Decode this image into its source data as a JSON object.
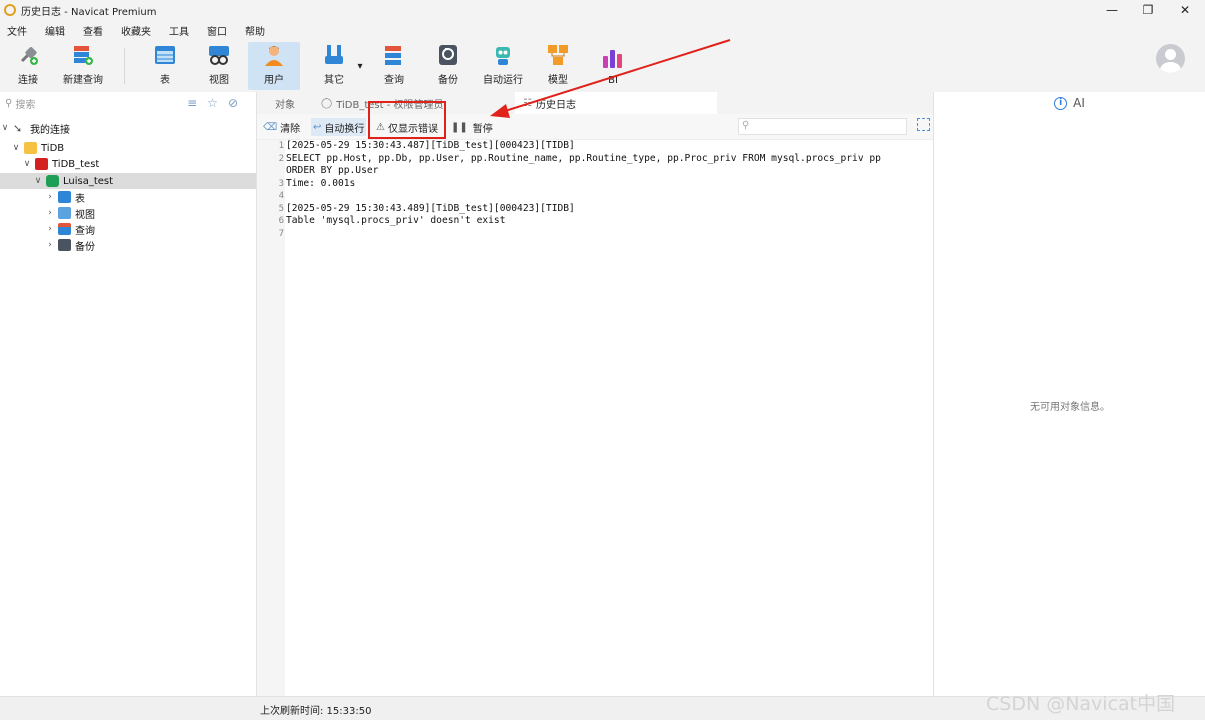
{
  "window": {
    "title": "历史日志 - Navicat Premium"
  },
  "menu": [
    "文件",
    "编辑",
    "查看",
    "收藏夹",
    "工具",
    "窗口",
    "帮助"
  ],
  "toolbar": {
    "connect": "连接",
    "new_query": "新建查询",
    "table": "表",
    "view": "视图",
    "user": "用户",
    "other": "其它",
    "query": "查询",
    "backup": "备份",
    "automation": "自动运行",
    "model": "模型",
    "bi": "BI"
  },
  "sidebar": {
    "search_placeholder": "搜索",
    "tree": {
      "root": "我的连接",
      "group": "TiDB",
      "connection": "TiDB_test",
      "database": "Luisa_test",
      "items": [
        "表",
        "视图",
        "查询",
        "备份"
      ]
    }
  },
  "tabs": [
    "对象",
    "TiDB_test - 权限管理员",
    "历史日志"
  ],
  "log_toolbar": {
    "clear": "清除",
    "word_wrap": "自动换行",
    "errors_only": "仅显示错误",
    "pause": "暂停"
  },
  "log_lines": [
    "[2025-05-29 15:30:43.487][TiDB_test][000423][TIDB]",
    "SELECT pp.Host, pp.Db, pp.User, pp.Routine_name, pp.Routine_type, pp.Proc_priv FROM mysql.procs_priv pp",
    "ORDER BY pp.User",
    "Time: 0.001s",
    "",
    "[2025-05-29 15:30:43.489][TiDB_test][000423][TIDB]",
    "Table 'mysql.procs_priv' doesn't exist",
    ""
  ],
  "line_numbers": [
    "1",
    "2",
    "",
    "3",
    "4",
    "5",
    "6",
    "7"
  ],
  "right_panel": {
    "title": "AI",
    "empty": "无可用对象信息。"
  },
  "status": {
    "last_refresh": "上次刷新时间: 15:33:50"
  },
  "watermark": "CSDN @Navicat中国",
  "colors": {
    "selection": "#cfe3f5",
    "annotation": "#e0221b",
    "tree_selected": "#dcdcdc"
  }
}
